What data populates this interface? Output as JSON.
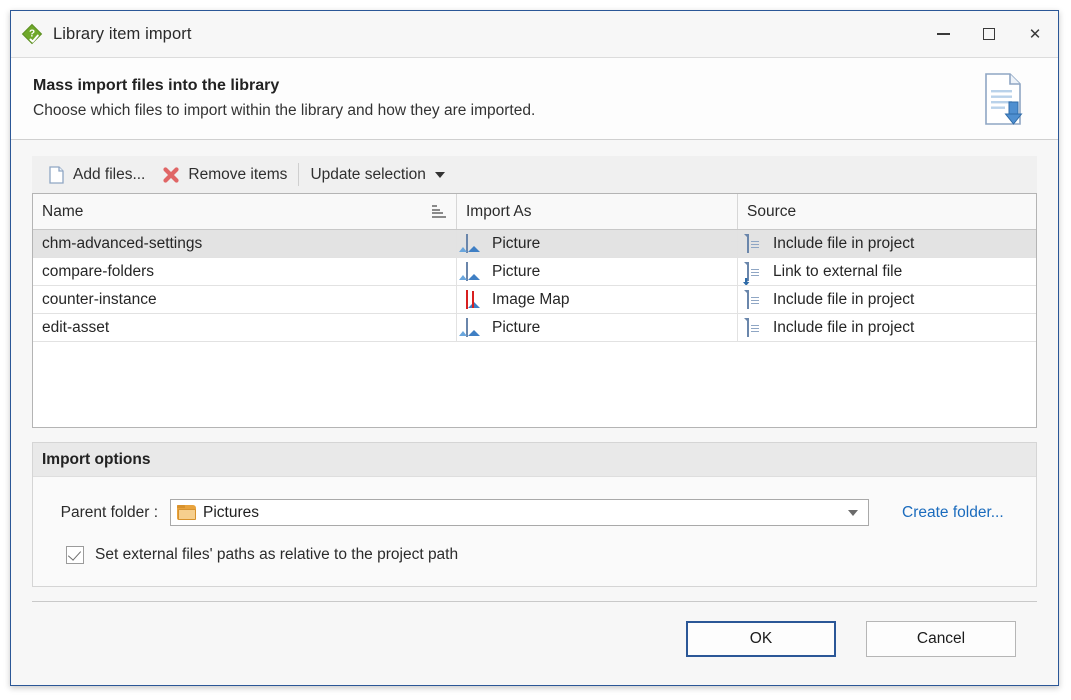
{
  "window": {
    "title": "Library item import",
    "icon": "help-library-icon",
    "controls": {
      "minimize": "minimize-icon",
      "maximize": "maximize-icon",
      "close": "close-icon"
    }
  },
  "header": {
    "title": "Mass import files into the library",
    "subtitle": "Choose which files to import within the library and how they are imported.",
    "icon": "document-import-icon"
  },
  "toolbar": {
    "add_files": "Add files...",
    "remove_items": "Remove items",
    "update_selection": "Update selection"
  },
  "table": {
    "columns": [
      "Name",
      "Import As",
      "Source"
    ],
    "sort_indicator": "sort-ascending-icon",
    "rows": [
      {
        "name": "chm-advanced-settings",
        "import_as": "Picture",
        "import_as_icon": "picture-icon",
        "source": "Include file in project",
        "source_icon": "file-include-icon",
        "selected": true
      },
      {
        "name": "compare-folders",
        "import_as": "Picture",
        "import_as_icon": "picture-icon",
        "source": "Link to external file",
        "source_icon": "file-link-icon",
        "selected": false
      },
      {
        "name": "counter-instance",
        "import_as": "Image Map",
        "import_as_icon": "image-map-icon",
        "source": "Include file in project",
        "source_icon": "file-include-icon",
        "selected": false
      },
      {
        "name": "edit-asset",
        "import_as": "Picture",
        "import_as_icon": "picture-icon",
        "source": "Include file in project",
        "source_icon": "file-include-icon",
        "selected": false
      }
    ]
  },
  "import_options": {
    "group_title": "Import options",
    "parent_folder_label": "Parent folder :",
    "parent_folder_value": "Pictures",
    "parent_folder_icon": "folder-icon",
    "create_folder_link": "Create folder...",
    "relative_paths_label": "Set external files' paths as relative to the project path",
    "relative_paths_checked": true
  },
  "footer": {
    "ok": "OK",
    "cancel": "Cancel"
  },
  "colors": {
    "accent": "#2b5797",
    "link": "#1a6bbd",
    "selection": "#e3e3e3",
    "icon_green": "#6fa82a",
    "icon_red": "#d81f1f",
    "folder_orange": "#e8a33d"
  }
}
